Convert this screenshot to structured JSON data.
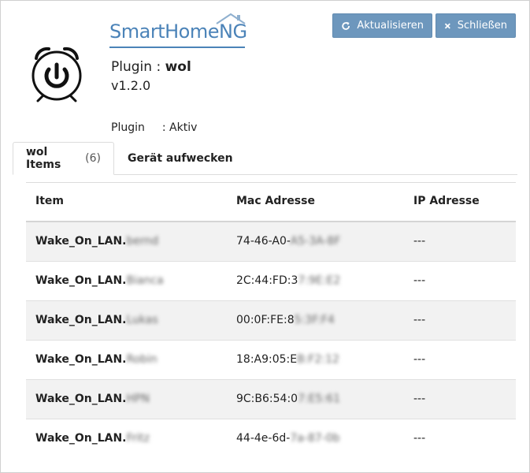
{
  "header": {
    "brand": {
      "part1": "SmartHome",
      "part2": "NG"
    },
    "plugin_label": "Plugin : ",
    "plugin_name": "wol",
    "version": "v1.2.0",
    "status_label": "Plugin",
    "status_value": ": Aktiv"
  },
  "toolbar": {
    "refresh_label": "Aktualisieren",
    "close_label": "Schließen"
  },
  "tabs": [
    {
      "label": "wol Items",
      "count": "(6)",
      "active": true
    },
    {
      "label": "Gerät aufwecken",
      "active": false
    }
  ],
  "table": {
    "headers": [
      "Item",
      "Mac Adresse",
      "IP Adresse"
    ],
    "rows": [
      {
        "item": "Wake_On_LAN.",
        "item_hidden": "bernd",
        "mac": "74-46-A0-",
        "mac_hidden": "A5-3A-8F",
        "ip": "---"
      },
      {
        "item": "Wake_On_LAN.",
        "item_hidden": "Bianca",
        "mac": "2C:44:FD:3",
        "mac_hidden": "7:9E:E2",
        "ip": "---"
      },
      {
        "item": "Wake_On_LAN.",
        "item_hidden": "Lukas",
        "mac": "00:0F:FE:8",
        "mac_hidden": "5:3F:F4",
        "ip": "---"
      },
      {
        "item": "Wake_On_LAN.",
        "item_hidden": "Robin",
        "mac": "18:A9:05:E",
        "mac_hidden": "B:F2:12",
        "ip": "---"
      },
      {
        "item": "Wake_On_LAN.",
        "item_hidden": "HPN",
        "mac": "9C:B6:54:0",
        "mac_hidden": "7:E5:61",
        "ip": "---"
      },
      {
        "item": "Wake_On_LAN.",
        "item_hidden": "Fritz",
        "mac": "44-4e-6d-",
        "mac_hidden": "7a-87-0b",
        "ip": "---"
      }
    ]
  },
  "colors": {
    "button": "#6d97bd",
    "brand": "#4b83b8",
    "row_stripe": "#f2f2f2"
  }
}
